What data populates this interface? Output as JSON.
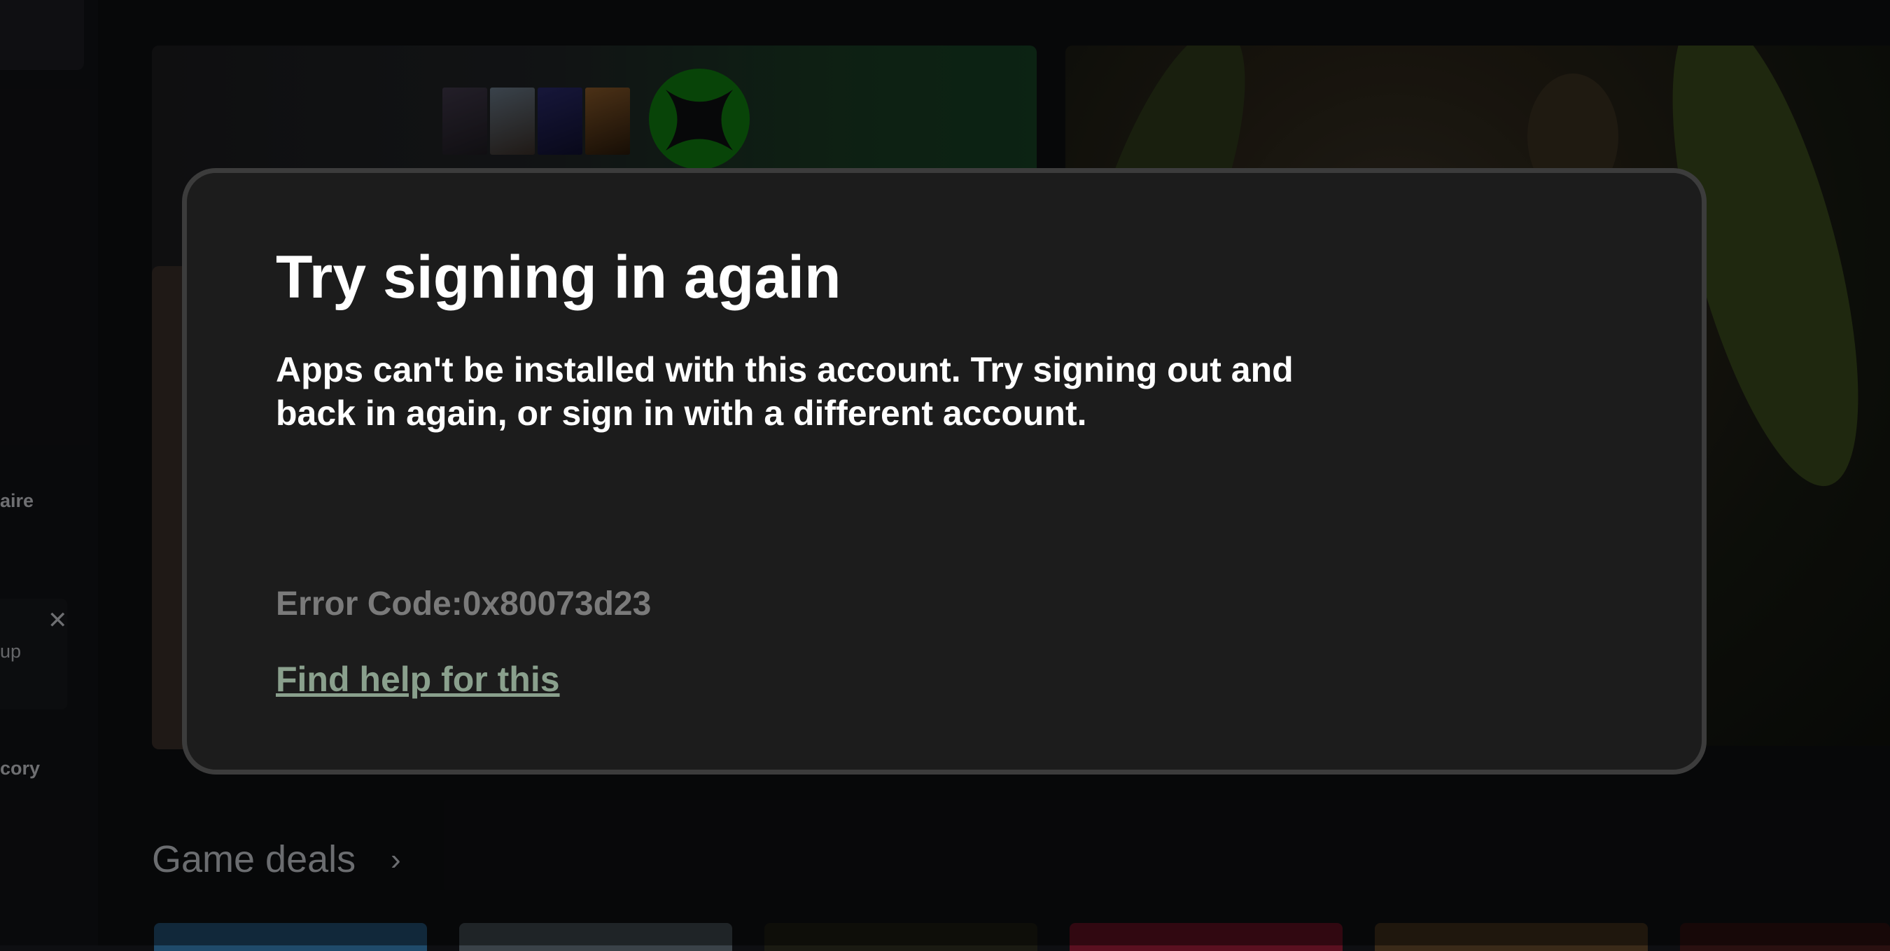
{
  "sidebar": {
    "items": [
      {
        "label": "aire"
      },
      {
        "label": "cory"
      }
    ],
    "notice": {
      "text": "up"
    }
  },
  "dialog": {
    "title": "Try signing in again",
    "message": "Apps can't be installed with this account. Try signing out and back in again, or sign in with a different account.",
    "error_code": "Error Code:0x80073d23",
    "help_link": "Find help for this"
  },
  "sections": {
    "game_deals": {
      "title": "Game deals"
    }
  },
  "colors": {
    "dialog_background": "#1c1c1c",
    "dialog_border": "#3c3c3c",
    "error_text": "#7a7a7a",
    "link": "#8aa08d",
    "xbox_green": "#107c10"
  }
}
